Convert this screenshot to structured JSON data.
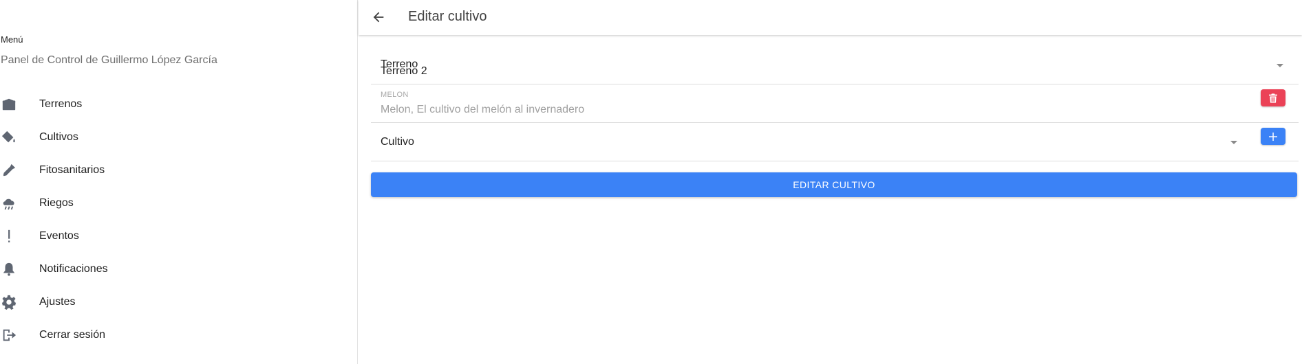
{
  "sidebar": {
    "title": "Menú",
    "subtitle": "Panel de Control de Guillermo López García",
    "items": [
      {
        "label": "Terrenos",
        "icon": "warehouse-icon"
      },
      {
        "label": "Cultivos",
        "icon": "paint-bucket-icon"
      },
      {
        "label": "Fitosanitarios",
        "icon": "eyedropper-icon"
      },
      {
        "label": "Riegos",
        "icon": "cloud-rain-icon"
      },
      {
        "label": "Eventos",
        "icon": "exclamation-icon"
      },
      {
        "label": "Notificaciones",
        "icon": "bell-icon"
      },
      {
        "label": "Ajustes",
        "icon": "gear-icon"
      },
      {
        "label": "Cerrar sesión",
        "icon": "logout-icon"
      }
    ]
  },
  "topbar": {
    "title": "Editar cultivo",
    "back_icon": "arrow-left-icon"
  },
  "form": {
    "terreno": {
      "label": "Terreno",
      "value": "Terreno 2"
    },
    "crop_entry": {
      "caption": "MELON",
      "description": "Melon, El cultivo del melón al invernadero"
    },
    "cultivo": {
      "label": "Cultivo"
    },
    "submit_label": "EDITAR CULTIVO"
  },
  "colors": {
    "primary": "#3b82f6",
    "danger": "#eb4257",
    "icon": "#5f6672"
  }
}
